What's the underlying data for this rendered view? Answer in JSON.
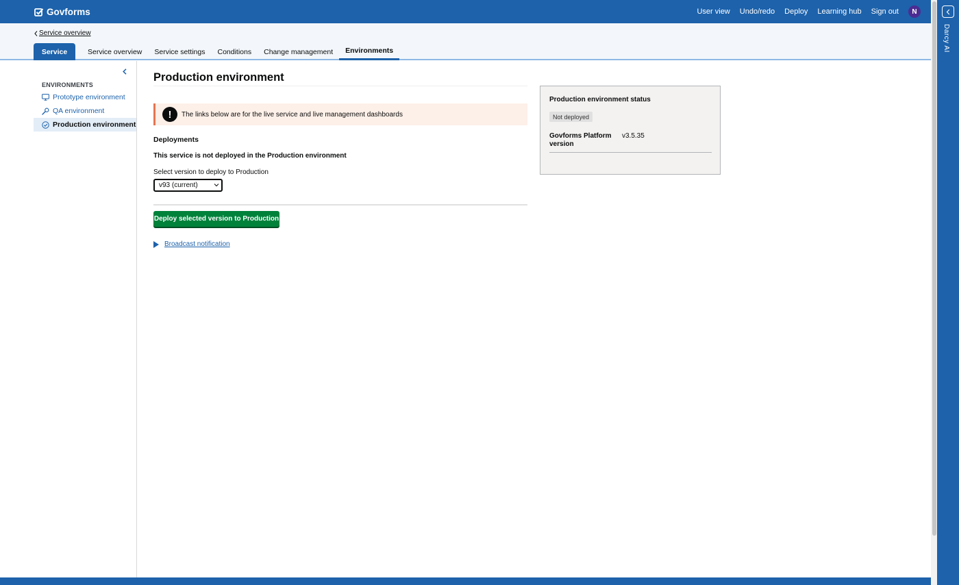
{
  "header": {
    "brand": "Govforms",
    "nav": [
      "User view",
      "Undo/redo",
      "Deploy",
      "Learning hub",
      "Sign out"
    ],
    "avatar_initial": "N"
  },
  "subheader": {
    "back_link": "Service overview",
    "tabs": [
      {
        "label": "Service",
        "state": "primary"
      },
      {
        "label": "Service overview"
      },
      {
        "label": "Service settings"
      },
      {
        "label": "Conditions"
      },
      {
        "label": "Change management"
      },
      {
        "label": "Environments",
        "state": "active"
      }
    ]
  },
  "sidebar": {
    "heading": "ENVIRONMENTS",
    "items": [
      {
        "label": "Prototype environment",
        "icon": "monitor-icon"
      },
      {
        "label": "QA environment",
        "icon": "wrench-icon"
      },
      {
        "label": "Production environment",
        "icon": "check-circle-icon",
        "active": true
      }
    ]
  },
  "main": {
    "title": "Production environment",
    "alert": "The links below are for the live service and live management dashboards",
    "alert_icon": "!",
    "deployments_heading": "Deployments",
    "deploy_message": "This service is not deployed in the Production environment",
    "select_label": "Select version to deploy to Production",
    "selected_version": "v93 (current)",
    "deploy_button": "Deploy selected version to Production",
    "broadcast_label": "Broadcast notification"
  },
  "status_panel": {
    "title": "Production environment status",
    "status_tag": "Not deployed",
    "platform_key": "Govforms Platform version",
    "platform_value": "v3.5.35"
  },
  "assistant": {
    "label": "Darcy AI"
  },
  "colors": {
    "brand_blue": "#1d62ab",
    "button_green": "#00823b",
    "alert_orange": "#e8744f",
    "avatar_purple": "#4c2c92"
  }
}
